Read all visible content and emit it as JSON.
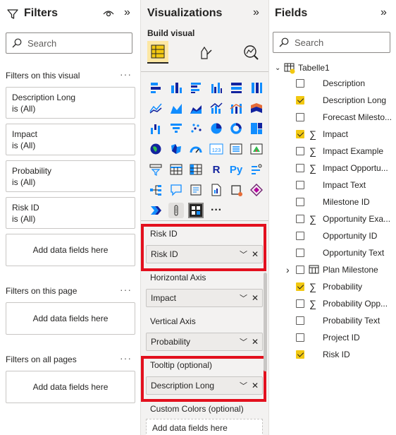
{
  "filters": {
    "title": "Filters",
    "search_placeholder": "Search",
    "on_visual": {
      "title": "Filters on this visual",
      "dots": "···",
      "cards": [
        {
          "name": "Description Long",
          "value": "is (All)"
        },
        {
          "name": "Impact",
          "value": "is (All)"
        },
        {
          "name": "Probability",
          "value": "is (All)"
        },
        {
          "name": "Risk ID",
          "value": "is (All)"
        }
      ],
      "add_label": "Add data fields here"
    },
    "on_page": {
      "title": "Filters on this page",
      "dots": "···",
      "add_label": "Add data fields here"
    },
    "on_all": {
      "title": "Filters on all pages",
      "dots": "···",
      "add_label": "Add data fields here"
    }
  },
  "visualizations": {
    "title": "Visualizations",
    "build_label": "Build visual",
    "more_label": "···",
    "wells": [
      {
        "label": "Risk ID",
        "field": "Risk ID",
        "highlighted": true
      },
      {
        "label": "Horizontal Axis",
        "field": "Impact",
        "highlighted": false
      },
      {
        "label": "Vertical Axis",
        "field": "Probability",
        "highlighted": false
      },
      {
        "label": "Tooltip (optional)",
        "field": "Description Long",
        "highlighted": true
      }
    ],
    "custom_colors": {
      "label": "Custom Colors (optional)",
      "add_label": "Add data fields here"
    },
    "text_icons": {
      "r": "R",
      "py": "Py",
      "kpi": "123"
    }
  },
  "fields": {
    "title": "Fields",
    "search_placeholder": "Search",
    "table": "Tabelle1",
    "items": [
      {
        "name": "Description",
        "checked": false,
        "sigma": false
      },
      {
        "name": "Description Long",
        "checked": true,
        "sigma": false
      },
      {
        "name": "Forecast Milesto...",
        "checked": false,
        "sigma": false
      },
      {
        "name": "Impact",
        "checked": true,
        "sigma": true
      },
      {
        "name": "Impact Example",
        "checked": false,
        "sigma": true
      },
      {
        "name": "Impact Opportu...",
        "checked": false,
        "sigma": true
      },
      {
        "name": "Impact Text",
        "checked": false,
        "sigma": false
      },
      {
        "name": "Milestone ID",
        "checked": false,
        "sigma": false
      },
      {
        "name": "Opportunity Exa...",
        "checked": false,
        "sigma": true
      },
      {
        "name": "Opportunity ID",
        "checked": false,
        "sigma": false
      },
      {
        "name": "Opportunity Text",
        "checked": false,
        "sigma": false
      },
      {
        "name": "Plan Milestone",
        "checked": false,
        "sigma": false,
        "hierarchy": true
      },
      {
        "name": "Probability",
        "checked": true,
        "sigma": true
      },
      {
        "name": "Probability Opp...",
        "checked": false,
        "sigma": true
      },
      {
        "name": "Probability Text",
        "checked": false,
        "sigma": false
      },
      {
        "name": "Project ID",
        "checked": false,
        "sigma": false
      },
      {
        "name": "Risk ID",
        "checked": true,
        "sigma": false
      }
    ]
  },
  "colors": {
    "accent": "#f2c811",
    "highlight_frame": "#e3101e",
    "pane_bg": "#f3f2f1"
  }
}
